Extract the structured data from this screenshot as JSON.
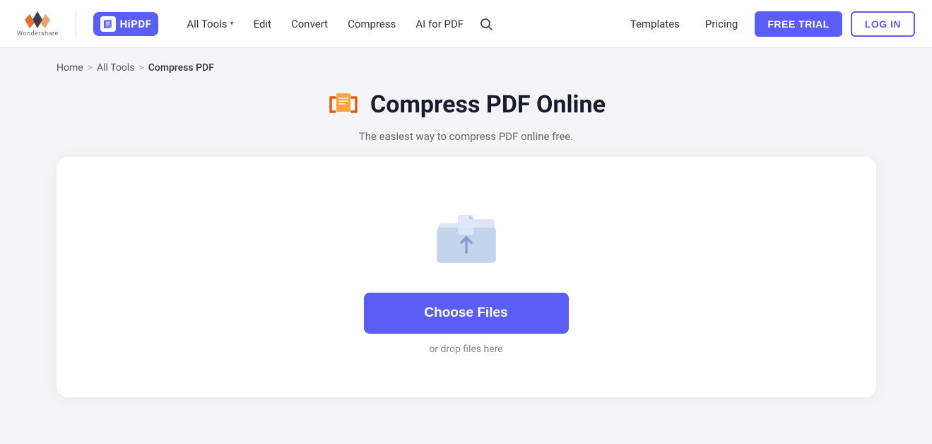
{
  "brand": {
    "wondershare_alt": "Wondershare",
    "hipdf_label": "HiPDF"
  },
  "nav": {
    "all_tools_label": "All Tools",
    "edit_label": "Edit",
    "convert_label": "Convert",
    "compress_label": "Compress",
    "ai_for_pdf_label": "AI for PDF",
    "templates_label": "Templates",
    "pricing_label": "Pricing",
    "free_trial_label": "FREE TRIAL",
    "login_label": "LOG IN"
  },
  "breadcrumb": {
    "home": "Home",
    "all_tools": "All Tools",
    "current": "Compress PDF",
    "sep1": ">",
    "sep2": ">"
  },
  "page": {
    "title": "Compress PDF Online",
    "subtitle": "The easiest way to compress PDF online free."
  },
  "upload": {
    "choose_files_label": "Choose Files",
    "drop_hint": "or drop files here"
  }
}
